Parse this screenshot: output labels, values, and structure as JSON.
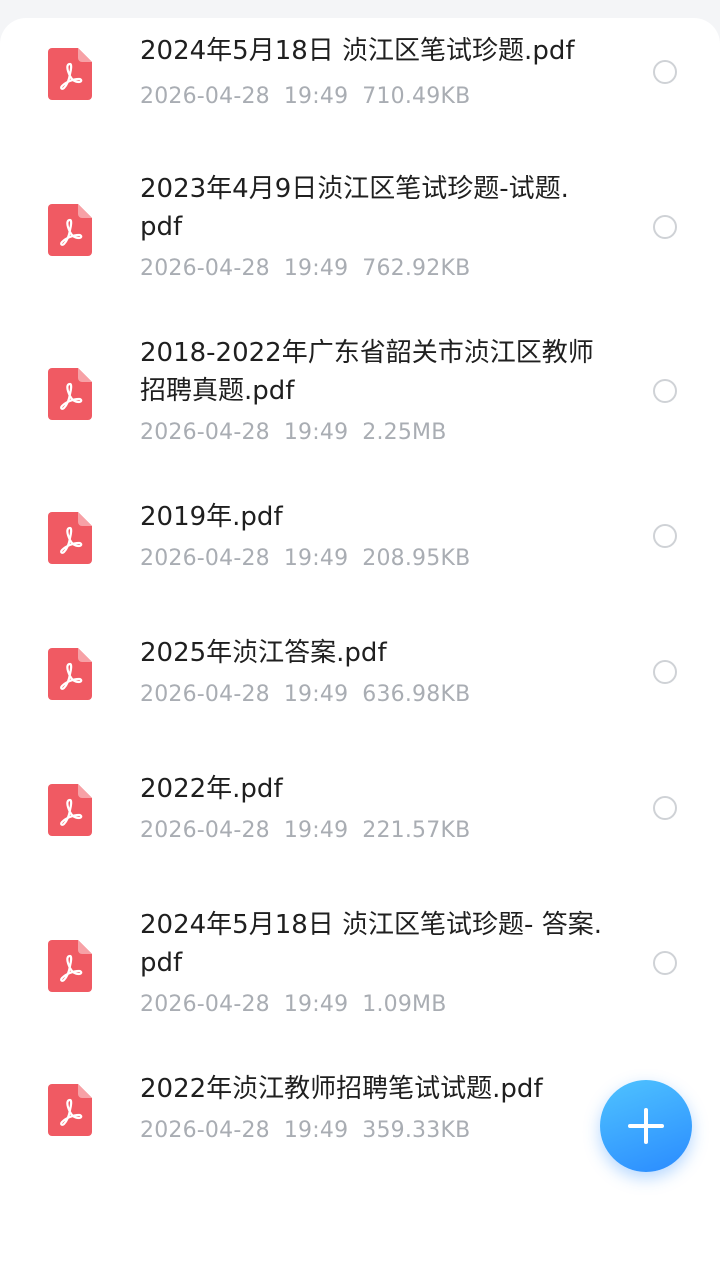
{
  "files": [
    {
      "name": "2024年5月18日 浈江区笔试珍题.pdf",
      "date": "2026-04-28",
      "time": "19:49",
      "size": "710.49KB"
    },
    {
      "name": "2023年4月9日浈江区笔试珍题-试题.pdf",
      "date": "2026-04-28",
      "time": "19:49",
      "size": "762.92KB"
    },
    {
      "name": "2018-2022年广东省韶关市浈江区教师招聘真题.pdf",
      "date": "2026-04-28",
      "time": "19:49",
      "size": "2.25MB"
    },
    {
      "name": "2019年.pdf",
      "date": "2026-04-28",
      "time": "19:49",
      "size": "208.95KB"
    },
    {
      "name": "2025年浈江答案.pdf",
      "date": "2026-04-28",
      "time": "19:49",
      "size": "636.98KB"
    },
    {
      "name": "2022年.pdf",
      "date": "2026-04-28",
      "time": "19:49",
      "size": "221.57KB"
    },
    {
      "name": "2024年5月18日 浈江区笔试珍题- 答案.pdf",
      "date": "2026-04-28",
      "time": "19:49",
      "size": "1.09MB"
    },
    {
      "name": "2022年浈江教师招聘笔试试题.pdf",
      "date": "2026-04-28",
      "time": "19:49",
      "size": "359.33KB"
    }
  ],
  "icons": {
    "file_type": "pdf-icon",
    "select": "radio-icon",
    "fab": "plus-icon"
  },
  "colors": {
    "pdf_icon": "#f05a63",
    "fab_start": "#4fc3ff",
    "fab_end": "#2a8bff",
    "meta_text": "#a9adb3"
  }
}
